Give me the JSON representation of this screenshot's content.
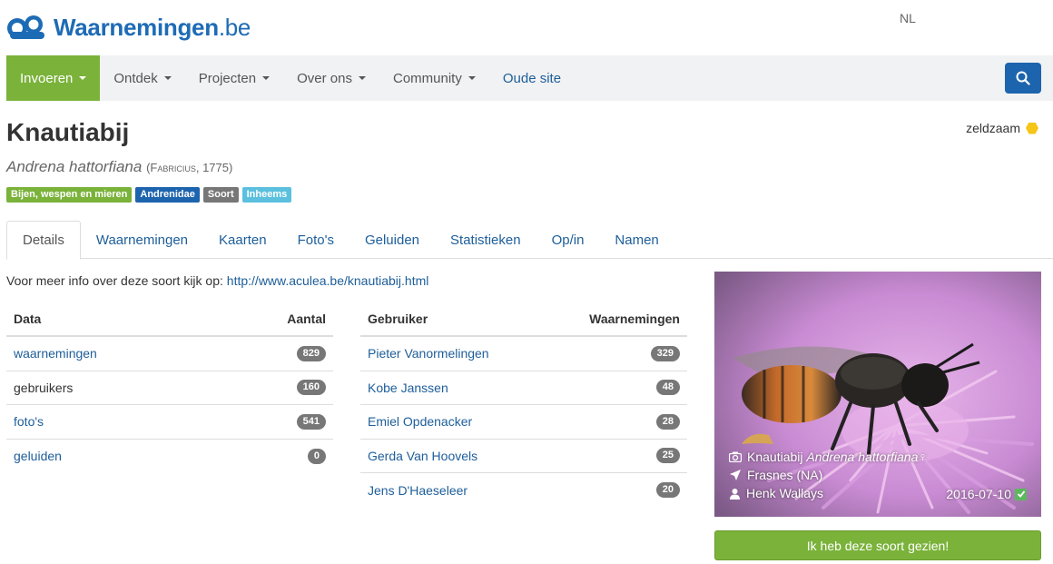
{
  "header": {
    "logo_main": "Waarnemingen",
    "logo_tld": ".be",
    "language": "NL"
  },
  "nav": {
    "items": [
      {
        "label": "Invoeren",
        "dropdown": true,
        "active": true
      },
      {
        "label": "Ontdek",
        "dropdown": true
      },
      {
        "label": "Projecten",
        "dropdown": true
      },
      {
        "label": "Over ons",
        "dropdown": true
      },
      {
        "label": "Community",
        "dropdown": true
      },
      {
        "label": "Oude site",
        "dropdown": false
      }
    ],
    "search_icon": "search-icon"
  },
  "species": {
    "common_name": "Knautiabij",
    "scientific_name": "Andrena hattorfiana",
    "author": "(Fabricius, 1775)",
    "rarity": "zeldzaam",
    "rarity_color": "#f5c518",
    "tags": [
      {
        "label": "Bijen, wespen en mieren",
        "color": "#7ab23a"
      },
      {
        "label": "Andrenidae",
        "color": "#1d64ae"
      },
      {
        "label": "Soort",
        "color": "#777777"
      },
      {
        "label": "Inheems",
        "color": "#5bc0de"
      }
    ]
  },
  "tabs": [
    "Details",
    "Waarnemingen",
    "Kaarten",
    "Foto's",
    "Geluiden",
    "Statistieken",
    "Op/in",
    "Namen"
  ],
  "intro": {
    "text": "Voor meer info over deze soort kijk op:",
    "link": "http://www.aculea.be/knautiabij.html"
  },
  "data_table": {
    "headers": [
      "Data",
      "Aantal"
    ],
    "rows": [
      {
        "label": "waarnemingen",
        "value": "829",
        "link": true
      },
      {
        "label": "gebruikers",
        "value": "160",
        "link": false
      },
      {
        "label": "foto's",
        "value": "541",
        "link": true
      },
      {
        "label": "geluiden",
        "value": "0",
        "link": true
      }
    ]
  },
  "user_table": {
    "headers": [
      "Gebruiker",
      "Waarnemingen"
    ],
    "rows": [
      {
        "label": "Pieter Vanormelingen",
        "value": "329"
      },
      {
        "label": "Kobe Janssen",
        "value": "48"
      },
      {
        "label": "Emiel Opdenacker",
        "value": "28"
      },
      {
        "label": "Gerda Van Hoovels",
        "value": "25"
      },
      {
        "label": "Jens D'Haeseleer",
        "value": "20"
      }
    ]
  },
  "photo": {
    "common_name": "Knautiabij",
    "scientific_name": "Andrena hattorfiana",
    "sex_symbol": "♀",
    "location": "Frasnes (NA)",
    "photographer": "Henk Wallays",
    "date": "2016-07-10"
  },
  "seen_button": "Ik heb deze soort gezien!"
}
